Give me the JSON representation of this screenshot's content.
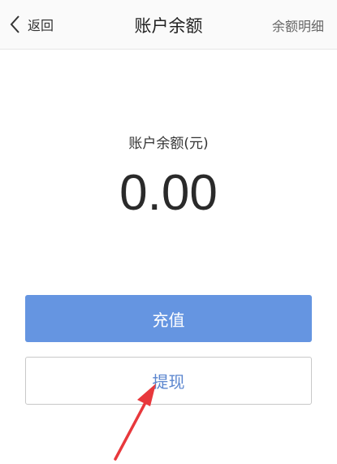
{
  "nav": {
    "back_label": "返回",
    "title": "账户余额",
    "detail_label": "余额明细"
  },
  "balance": {
    "label": "账户余额(元)",
    "amount": "0.00"
  },
  "actions": {
    "recharge_label": "充值",
    "withdraw_label": "提现"
  },
  "colors": {
    "primary_button": "#6595e1",
    "withdraw_text": "#5b86cf",
    "annotation_arrow": "#e8383c"
  },
  "icons": {
    "back": "chevron-left-icon",
    "annotation": "red-arrow-icon"
  }
}
